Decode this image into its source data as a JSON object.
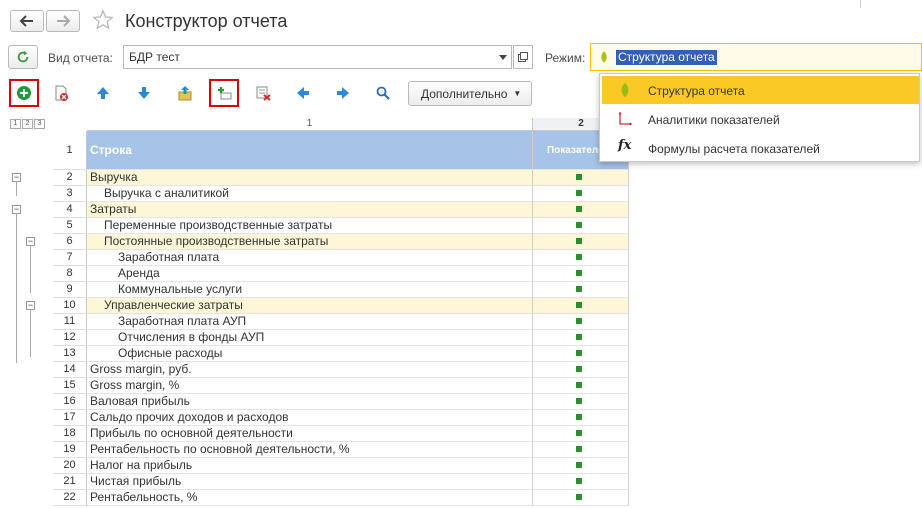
{
  "window": {
    "title": "Конструктор отчета"
  },
  "params": {
    "report_type_label": "Вид отчета:",
    "report_type_value": "БДР тест",
    "mode_label": "Режим:",
    "mode_value": "Структура отчета"
  },
  "toolbar": {
    "more_label": "Дополнительно"
  },
  "mode_menu": {
    "items": [
      {
        "label": "Структура отчета",
        "icon": "leaf-icon",
        "active": true
      },
      {
        "label": "Аналитики показателей",
        "icon": "axes-icon",
        "active": false
      },
      {
        "label": "Формулы расчета показателей",
        "icon": "fx-icon",
        "active": false
      }
    ]
  },
  "grid": {
    "level_buttons": [
      "1",
      "2",
      "3"
    ],
    "col1_number": "1",
    "col2_number": "2",
    "header": {
      "rownum": "1",
      "row_label": "Строка",
      "indicator_label": "Показатели"
    },
    "rows": [
      {
        "n": "2",
        "label": "Выручка",
        "indent": 0,
        "group": true
      },
      {
        "n": "3",
        "label": "Выручка с аналитикой",
        "indent": 1,
        "group": false
      },
      {
        "n": "4",
        "label": "Затраты",
        "indent": 0,
        "group": true
      },
      {
        "n": "5",
        "label": "Переменные производственные затраты",
        "indent": 1,
        "group": false
      },
      {
        "n": "6",
        "label": "Постоянные производственные затраты",
        "indent": 1,
        "group": true
      },
      {
        "n": "7",
        "label": "Заработная плата",
        "indent": 2,
        "group": false
      },
      {
        "n": "8",
        "label": "Аренда",
        "indent": 2,
        "group": false
      },
      {
        "n": "9",
        "label": "Коммунальные услуги",
        "indent": 2,
        "group": false
      },
      {
        "n": "10",
        "label": "Управленческие затраты",
        "indent": 1,
        "group": true
      },
      {
        "n": "11",
        "label": "Заработная плата АУП",
        "indent": 2,
        "group": false
      },
      {
        "n": "12",
        "label": "Отчисления в фонды АУП",
        "indent": 2,
        "group": false
      },
      {
        "n": "13",
        "label": "Офисные расходы",
        "indent": 2,
        "group": false
      },
      {
        "n": "14",
        "label": "Gross margin, руб.",
        "indent": 0,
        "group": false
      },
      {
        "n": "15",
        "label": "Gross margin, %",
        "indent": 0,
        "group": false
      },
      {
        "n": "16",
        "label": "Валовая прибыль",
        "indent": 0,
        "group": false
      },
      {
        "n": "17",
        "label": "Сальдо прочих доходов и расходов",
        "indent": 0,
        "group": false
      },
      {
        "n": "18",
        "label": "Прибыль по основной деятельности",
        "indent": 0,
        "group": false
      },
      {
        "n": "19",
        "label": "Рентабельность по основной деятельности, %",
        "indent": 0,
        "group": false
      },
      {
        "n": "20",
        "label": "Налог на прибыль",
        "indent": 0,
        "group": false
      },
      {
        "n": "21",
        "label": "Чистая прибыль",
        "indent": 0,
        "group": false
      },
      {
        "n": "22",
        "label": "Рентабельность, %",
        "indent": 0,
        "group": false
      }
    ]
  }
}
